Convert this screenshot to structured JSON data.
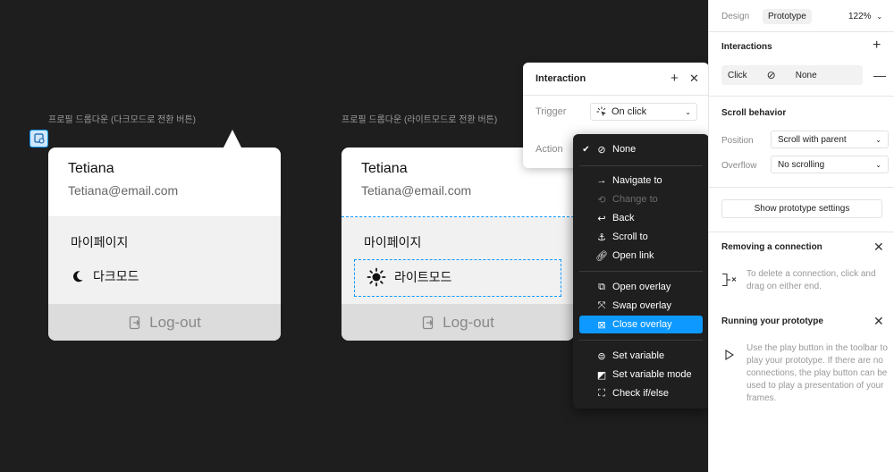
{
  "canvas": {
    "frame1_label": "프로필 드롭다운 (다크모드로 전환 버튼)",
    "frame2_label": "프로필 드롭다운 (라이트모드로 전환 버튼)",
    "card1": {
      "name": "Tetiana",
      "email": "Tetiana@email.com",
      "mypage": "마이페이지",
      "mode": "다크모드",
      "logout": "Log-out"
    },
    "card2": {
      "name": "Tetiana",
      "email": "Tetiana@email.com",
      "mypage": "마이페이지",
      "mode": "라이트모드",
      "logout": "Log-out"
    }
  },
  "interaction_popover": {
    "title": "Interaction",
    "trigger_label": "Trigger",
    "trigger_value": "On click",
    "action_label": "Action"
  },
  "action_menu": {
    "items": [
      {
        "label": "None",
        "icon": "none-icon",
        "checked": true
      },
      {
        "label": "Navigate to",
        "icon": "arrow-right-icon"
      },
      {
        "label": "Change to",
        "icon": "change-icon",
        "disabled": true
      },
      {
        "label": "Back",
        "icon": "back-icon"
      },
      {
        "label": "Scroll to",
        "icon": "anchor-icon"
      },
      {
        "label": "Open link",
        "icon": "link-icon"
      },
      {
        "label": "Open overlay",
        "icon": "open-overlay-icon"
      },
      {
        "label": "Swap overlay",
        "icon": "swap-overlay-icon"
      },
      {
        "label": "Close overlay",
        "icon": "close-overlay-icon",
        "selected": true
      },
      {
        "label": "Set variable",
        "icon": "set-variable-icon"
      },
      {
        "label": "Set variable mode",
        "icon": "variable-mode-icon"
      },
      {
        "label": "Check if/else",
        "icon": "if-else-icon"
      }
    ]
  },
  "panel": {
    "tab_design": "Design",
    "tab_prototype": "Prototype",
    "zoom": "122%",
    "interactions_title": "Interactions",
    "interaction_trigger": "Click",
    "interaction_action": "None",
    "scroll_title": "Scroll behavior",
    "position_label": "Position",
    "position_value": "Scroll with parent",
    "overflow_label": "Overflow",
    "overflow_value": "No scrolling",
    "show_settings": "Show prototype settings",
    "removing_title": "Removing a connection",
    "removing_help": "To delete a connection, click and drag on either end.",
    "running_title": "Running your prototype",
    "running_help": "Use the play button in the toolbar to play your prototype. If there are no connections, the play button can be used to play a presentation of your frames."
  },
  "colors": {
    "accent": "#0d99ff",
    "canvas_bg": "#1e1e1e",
    "menu_bg": "#1f1f1f"
  }
}
